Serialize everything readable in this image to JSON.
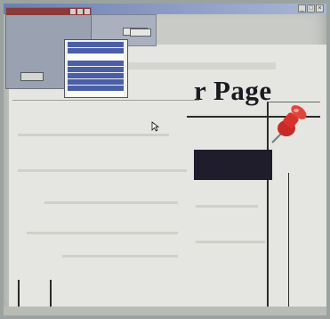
{
  "window": {
    "title": "",
    "controls": {
      "minimize": "_",
      "maximize": "□",
      "close": "×"
    }
  },
  "dialog": {
    "label_1": "",
    "label_2": "",
    "ok_label": ""
  },
  "properties": {
    "tab_a": "",
    "tab_b": "",
    "field_1": "",
    "field_2": ""
  },
  "dropdown": {
    "items": [
      "",
      "",
      "",
      "",
      "",
      "",
      "",
      "",
      "",
      ""
    ]
  },
  "page": {
    "heading": "r Page",
    "text_lines": [
      "",
      "",
      ""
    ]
  },
  "taskbar": {
    "items_text": "",
    "tray_text": ""
  },
  "colors": {
    "title_gradient_start": "#6b7fb0",
    "dialog_titlebar": "#8b3a3a",
    "selection_blue": "#4a5fa8",
    "pushpin_red": "#d8322c",
    "text_block_bg": "#1f1d2c"
  },
  "icons": {
    "cursor": "arrow-cursor-icon",
    "pushpin": "pushpin-icon"
  }
}
